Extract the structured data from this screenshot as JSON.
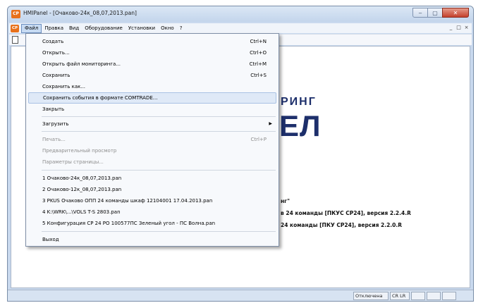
{
  "window": {
    "app_icon_label": "CP",
    "title": "HMIPanel - [Очаково-24к_08,07,2013.pan]",
    "controls": {
      "minimize": "‒",
      "maximize": "▢",
      "close": "✕"
    }
  },
  "menubar": {
    "mdi_icon_label": "CP",
    "items": [
      "Файл",
      "Правка",
      "Вид",
      "Оборудование",
      "Установки",
      "Окно",
      "?"
    ],
    "mdi_controls": [
      "_",
      "□",
      "×"
    ]
  },
  "background": {
    "logo_top": "РИНГ",
    "logo_bottom": "ЕЛ",
    "line1": "нг\"",
    "line2": "в 24 команды [ПКУС СР24], версия 2.2.4.R",
    "line3": "24 команды [ПКУ СР24], версия 2.2.0.R"
  },
  "statusbar": {
    "status": "Отключена",
    "mode": "CR LR"
  },
  "file_menu": {
    "items": [
      {
        "label": "Создать",
        "shortcut": "Ctrl+N"
      },
      {
        "label": "Открыть...",
        "shortcut": "Ctrl+O"
      },
      {
        "label": "Открыть файл мониторинга...",
        "shortcut": "Ctrl+M"
      },
      {
        "label": "Сохранить",
        "shortcut": "Ctrl+S"
      },
      {
        "label": "Сохранить как...",
        "shortcut": ""
      },
      {
        "label": "Сохранить события в формате COMTRADE...",
        "shortcut": ""
      },
      {
        "label": "Закрыть",
        "shortcut": ""
      },
      {
        "label": "Загрузить",
        "shortcut": "",
        "arrow": "▶"
      },
      {
        "label": "Печать...",
        "shortcut": "Ctrl+P"
      },
      {
        "label": "Предварительный просмотр",
        "shortcut": ""
      },
      {
        "label": "Параметры страницы...",
        "shortcut": ""
      },
      {
        "label": "1 Очаково-24к_08,07,2013.pan",
        "shortcut": ""
      },
      {
        "label": "2 Очаково-12к_08,07,2013.pan",
        "shortcut": ""
      },
      {
        "label": "3 PKUS Очаково ОПП 24 команды шкаф 12104001 17.04.2013.pan",
        "shortcut": ""
      },
      {
        "label": "4 K:\\WRK\\...\\VOLS T-S 2803.pan",
        "shortcut": ""
      },
      {
        "label": "5 Конфигурация СР 24 РО 100577ПС Зеленый угол - ПС Волна.pan",
        "shortcut": ""
      },
      {
        "label": "Выход",
        "shortcut": ""
      }
    ]
  }
}
